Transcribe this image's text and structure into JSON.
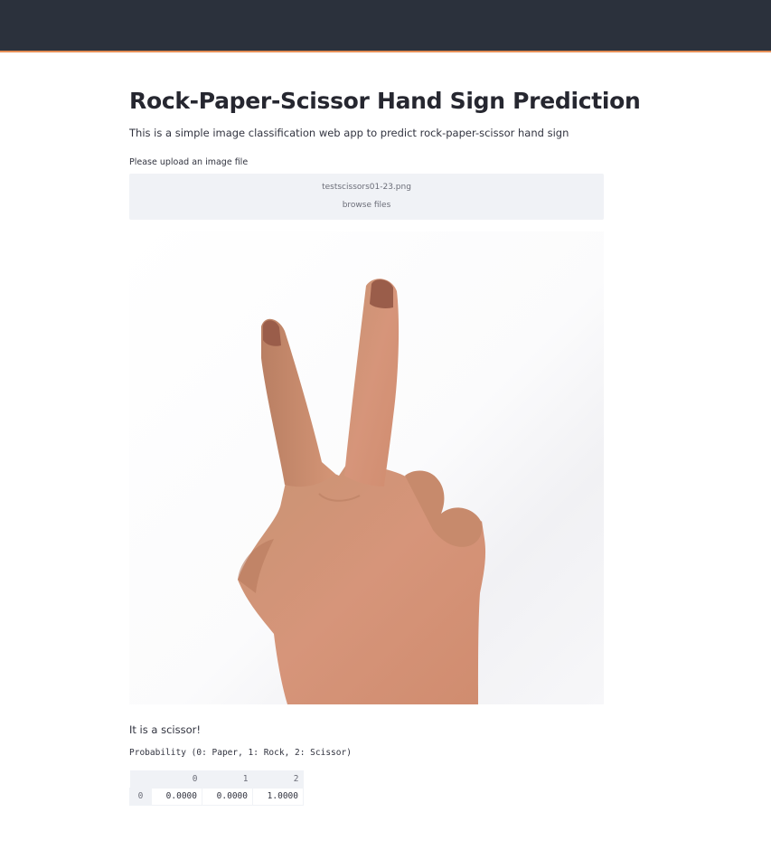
{
  "header": {
    "bar_color": "#2b313c",
    "accent_color": "#e07b39"
  },
  "title": "Rock-Paper-Scissor Hand Sign Prediction",
  "subtitle": "This is a simple image classification web app to predict rock-paper-scissor hand sign",
  "uploader": {
    "label": "Please upload an image file",
    "file_name": "testscissors01-23.png",
    "browse_label": "browse files"
  },
  "preview": {
    "icon": "uploaded-hand-image"
  },
  "result_text": "It is a scissor!",
  "probability_caption": "Probability (0: Paper, 1: Rock, 2: Scissor)",
  "probability_table": {
    "columns": [
      "0",
      "1",
      "2"
    ],
    "rows": [
      {
        "index": "0",
        "values": [
          "0.0000",
          "0.0000",
          "1.0000"
        ]
      }
    ]
  }
}
